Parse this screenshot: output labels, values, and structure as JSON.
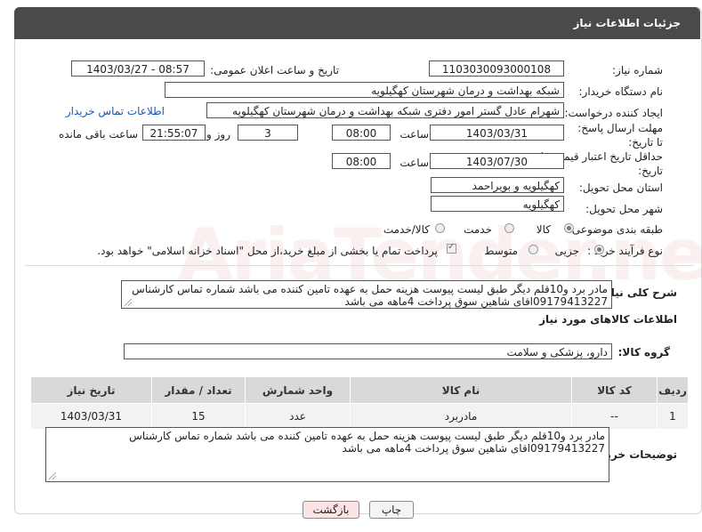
{
  "header": {
    "title": "جزئیات اطلاعات نیاز"
  },
  "fields": {
    "need_number_label": "شماره نیاز:",
    "need_number": "1103030093000108",
    "announce_label": "تاریخ و ساعت اعلان عمومی:",
    "announce_value": "1403/03/27 - 08:57",
    "buyer_org_label": "نام دستگاه خریدار:",
    "buyer_org": "شبکه بهداشت و درمان شهرستان کهگیلویه",
    "creator_label": "ایجاد کننده درخواست:",
    "creator": "شهرام عادل گستر امور دفتری شبکه بهداشت و درمان شهرستان کهگیلویه",
    "contact_link": "اطلاعات تماس خریدار",
    "deadline_label": "مهلت ارسال پاسخ: تا تاریخ:",
    "deadline_date": "1403/03/31",
    "time_label": "ساعت",
    "deadline_time": "08:00",
    "days_value": "3",
    "days_label": "روز و",
    "remaining_time": "21:55:07",
    "remaining_label": "ساعت باقی مانده",
    "validity_label": "حداقل تاریخ اعتبار قیمت: تا تاریخ:",
    "validity_date": "1403/07/30",
    "validity_time": "08:00",
    "province_label": "استان محل تحویل:",
    "province": "کهگیلویه و بویراحمد",
    "city_label": "شهر محل تحویل:",
    "city": "کهگیلویه",
    "category_label": "طبقه بندی موضوعی:",
    "category_options": [
      "کالا",
      "خدمت",
      "کالا/خدمت"
    ],
    "process_label": "نوع فرآیند خرید :",
    "process_options": [
      "جزیی",
      "متوسط"
    ],
    "payment_note": "پرداخت تمام یا بخشی از مبلغ خرید،از محل \"اسناد خزانه اسلامی\" خواهد بود."
  },
  "description": {
    "label": "شرح کلی نیاز:",
    "text": "مادر برد و10قلم دیگر طبق لیست پیوست هزینه حمل به عهده تامین کننده می باشد شماره تماس کارشناس 09179413227اقای شاهین سوق پرداخت 4ماهه می باشد"
  },
  "goods": {
    "section_title": "اطلاعات کالاهای مورد نیاز",
    "group_label": "گروه کالا:",
    "group_value": "دارو، پزشکی و سلامت",
    "columns": [
      "ردیف",
      "کد کالا",
      "نام کالا",
      "واحد شمارش",
      "تعداد / مقدار",
      "تاریخ نیاز"
    ],
    "rows": [
      [
        "1",
        "--",
        "مادربرد",
        "عدد",
        "15",
        "1403/03/31"
      ]
    ]
  },
  "buyer_notes": {
    "label": "توضیحات خریدار:",
    "text": "مادر برد و10قلم دیگر طبق لیست پیوست هزینه حمل به عهده تامین کننده می باشد شماره تماس کارشناس 09179413227اقای شاهین سوق پرداخت 4ماهه می باشد"
  },
  "buttons": {
    "print": "چاپ",
    "back": "بازگشت"
  },
  "colors": {
    "header_bg": "#4a4a4a",
    "link": "#1a57b3",
    "back_button_bg": "#fde4e4"
  }
}
